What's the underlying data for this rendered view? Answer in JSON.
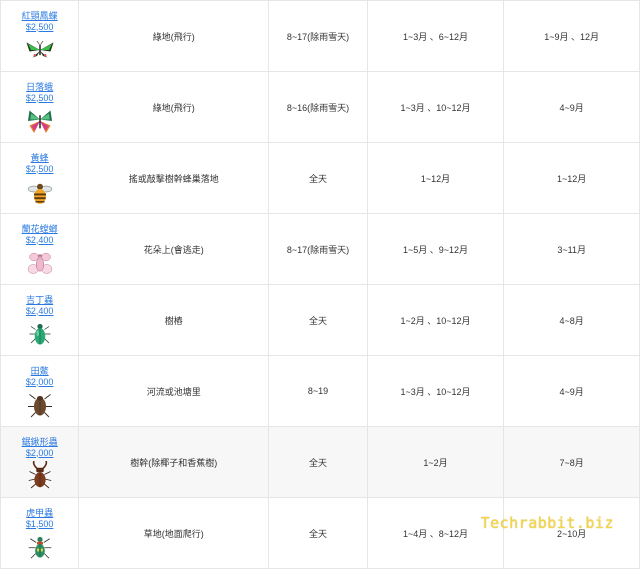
{
  "rows": [
    {
      "name": "紅頸鳳蝶",
      "price": "$2,500",
      "icon": "green-swallowtail-butterfly-icon",
      "location": "綠地(飛行)",
      "time": "8~17(除雨雪天)",
      "north": "1~3月 、6~12月",
      "south": "1~9月 、12月"
    },
    {
      "name": "日落蛾",
      "price": "$2,500",
      "icon": "sunset-moth-icon",
      "location": "綠地(飛行)",
      "time": "8~16(除雨雪天)",
      "north": "1~3月 、10~12月",
      "south": "4~9月"
    },
    {
      "name": "黃蜂",
      "price": "$2,500",
      "icon": "wasp-icon",
      "location": "搖或敲擊樹幹蜂巢落地",
      "time": "全天",
      "north": "1~12月",
      "south": "1~12月"
    },
    {
      "name": "蘭花螳螂",
      "price": "$2,400",
      "icon": "orchid-mantis-icon",
      "location": "花朵上(會逃走)",
      "time": "8~17(除雨雪天)",
      "north": "1~5月 、9~12月",
      "south": "3~11月"
    },
    {
      "name": "吉丁蟲",
      "price": "$2,400",
      "icon": "jewel-beetle-icon",
      "location": "樹樁",
      "time": "全天",
      "north": "1~2月 、10~12月",
      "south": "4~8月"
    },
    {
      "name": "田鱉",
      "price": "$2,000",
      "icon": "giant-water-bug-icon",
      "location": "河流或池塘里",
      "time": "8~19",
      "north": "1~3月 、10~12月",
      "south": "4~9月"
    },
    {
      "name": "鋸鍬形蟲",
      "price": "$2,000",
      "icon": "stag-beetle-icon",
      "location": "樹幹(除椰子和香蕉樹)",
      "time": "全天",
      "north": "1~2月",
      "south": "7~8月"
    },
    {
      "name": "虎甲蟲",
      "price": "$1,500",
      "icon": "tiger-beetle-icon",
      "location": "草地(地面爬行)",
      "time": "全天",
      "north": "1~4月 、8~12月",
      "south": "2~10月"
    }
  ],
  "watermark": "Techrabbit.biz"
}
